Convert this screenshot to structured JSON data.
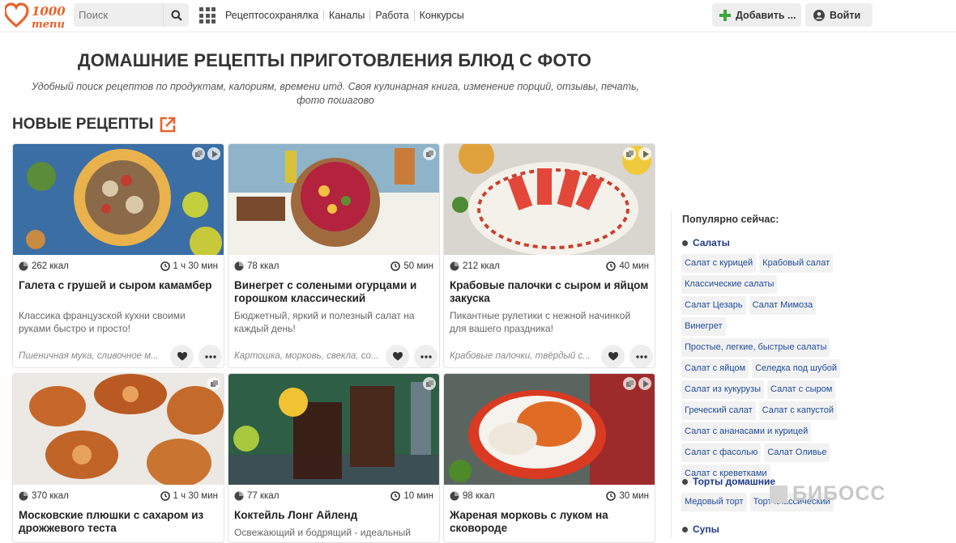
{
  "header": {
    "search_placeholder": "Поиск",
    "nav": [
      "Рецептосохранялка",
      "Каналы",
      "Работа",
      "Конкурсы"
    ],
    "add_label": "Добавить ...",
    "login_label": "Войти",
    "logo_text_top": "1000",
    "logo_text_bottom": "menu"
  },
  "page": {
    "title": "ДОМАШНИЕ РЕЦЕПТЫ ПРИГОТОВЛЕНИЯ БЛЮД С ФОТО",
    "subtitle": "Удобный поиск рецептов по продуктам, калориям, времени итд. Своя кулинарная книга, изменение порций, отзывы, печать, фото пошагово",
    "section_title": "НОВЫЕ РЕЦЕПТЫ"
  },
  "recipes": [
    {
      "kcal": "262 ккал",
      "time": "1 ч 30 мин",
      "title": "Галета с грушей и сыром камамбер",
      "desc": "Классика французской кухни своими руками быстро и просто!",
      "ingredients": "Пшеничная мука, сливочное м..."
    },
    {
      "kcal": "78 ккал",
      "time": "50 мин",
      "title": "Винегрет с солеными огурцами и горошком классический",
      "desc": "Бюджетный, яркий и полезный салат на каждый день!",
      "ingredients": "Картошка, морковь, свекла, со..."
    },
    {
      "kcal": "212 ккал",
      "time": "40 мин",
      "title": "Крабовые палочки с сыром и яйцом закуска",
      "desc": "Пикантные рулетики с нежной начинкой для вашего праздника!",
      "ingredients": "Крабовые палочки, твёрдый с..."
    },
    {
      "kcal": "370 ккал",
      "time": "1 ч 30 мин",
      "title": "Московские плюшки с сахаром из дрожжевого теста",
      "desc": "",
      "ingredients": ""
    },
    {
      "kcal": "77 ккал",
      "time": "10 мин",
      "title": "Коктейль Лонг Айленд",
      "desc": "Освежающий и бодрящий - идеальный микс",
      "ingredients": ""
    },
    {
      "kcal": "98 ккал",
      "time": "30 мин",
      "title": "Жареная морковь с луком на сковороде",
      "desc": "",
      "ingredients": ""
    }
  ],
  "sidebar": {
    "title": "Популярно сейчас:",
    "categories": [
      {
        "name": "Салаты",
        "tags": [
          "Салат с курицей",
          "Крабовый салат",
          "Классические салаты",
          "Салат Цезарь",
          "Салат Мимоза",
          "Винегрет",
          "Простые, легкие, быстрые салаты",
          "Салат с яйцом",
          "Селедка под шубой",
          "Салат из кукурузы",
          "Салат с сыром",
          "Греческий салат",
          "Салат с капустой",
          "Салат с ананасами и курицей",
          "Салат с фасолью",
          "Салат Оливье",
          "Салат с креветками"
        ]
      },
      {
        "name": "Торты домашние",
        "tags": [
          "Медовый торт",
          "Торт классический"
        ]
      },
      {
        "name": "Супы",
        "tags": []
      }
    ]
  },
  "watermark": "БИБОСС",
  "colors": {
    "accent": "#e8632b",
    "link": "#1e4a9a",
    "plus": "#3ca83c"
  }
}
